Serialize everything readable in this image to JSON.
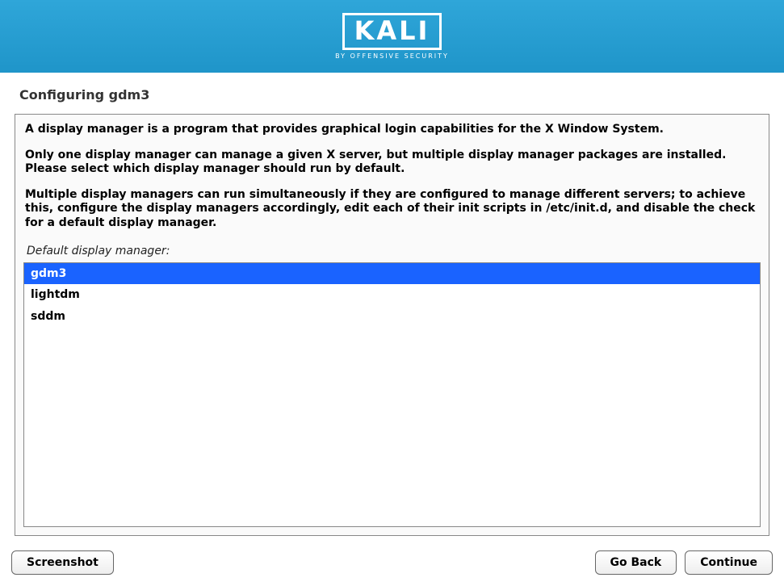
{
  "header": {
    "logo_text": "KALI",
    "logo_sub": "BY OFFENSIVE SECURITY"
  },
  "section_title": "Configuring gdm3",
  "description": {
    "p1": "A display manager is a program that provides graphical login capabilities for the X Window System.",
    "p2": "Only one display manager can manage a given X server, but multiple display manager packages are installed. Please select which display manager should run by default.",
    "p3": "Multiple display managers can run simultaneously if they are configured to manage different servers; to achieve this, configure the display managers accordingly, edit each of their init scripts in /etc/init.d, and disable the check for a default display manager."
  },
  "prompt_label": "Default display manager:",
  "options": {
    "0": {
      "label": "gdm3"
    },
    "1": {
      "label": "lightdm"
    },
    "2": {
      "label": "sddm"
    }
  },
  "selected_index": 0,
  "buttons": {
    "screenshot": "Screenshot",
    "go_back": "Go Back",
    "continue": "Continue"
  }
}
